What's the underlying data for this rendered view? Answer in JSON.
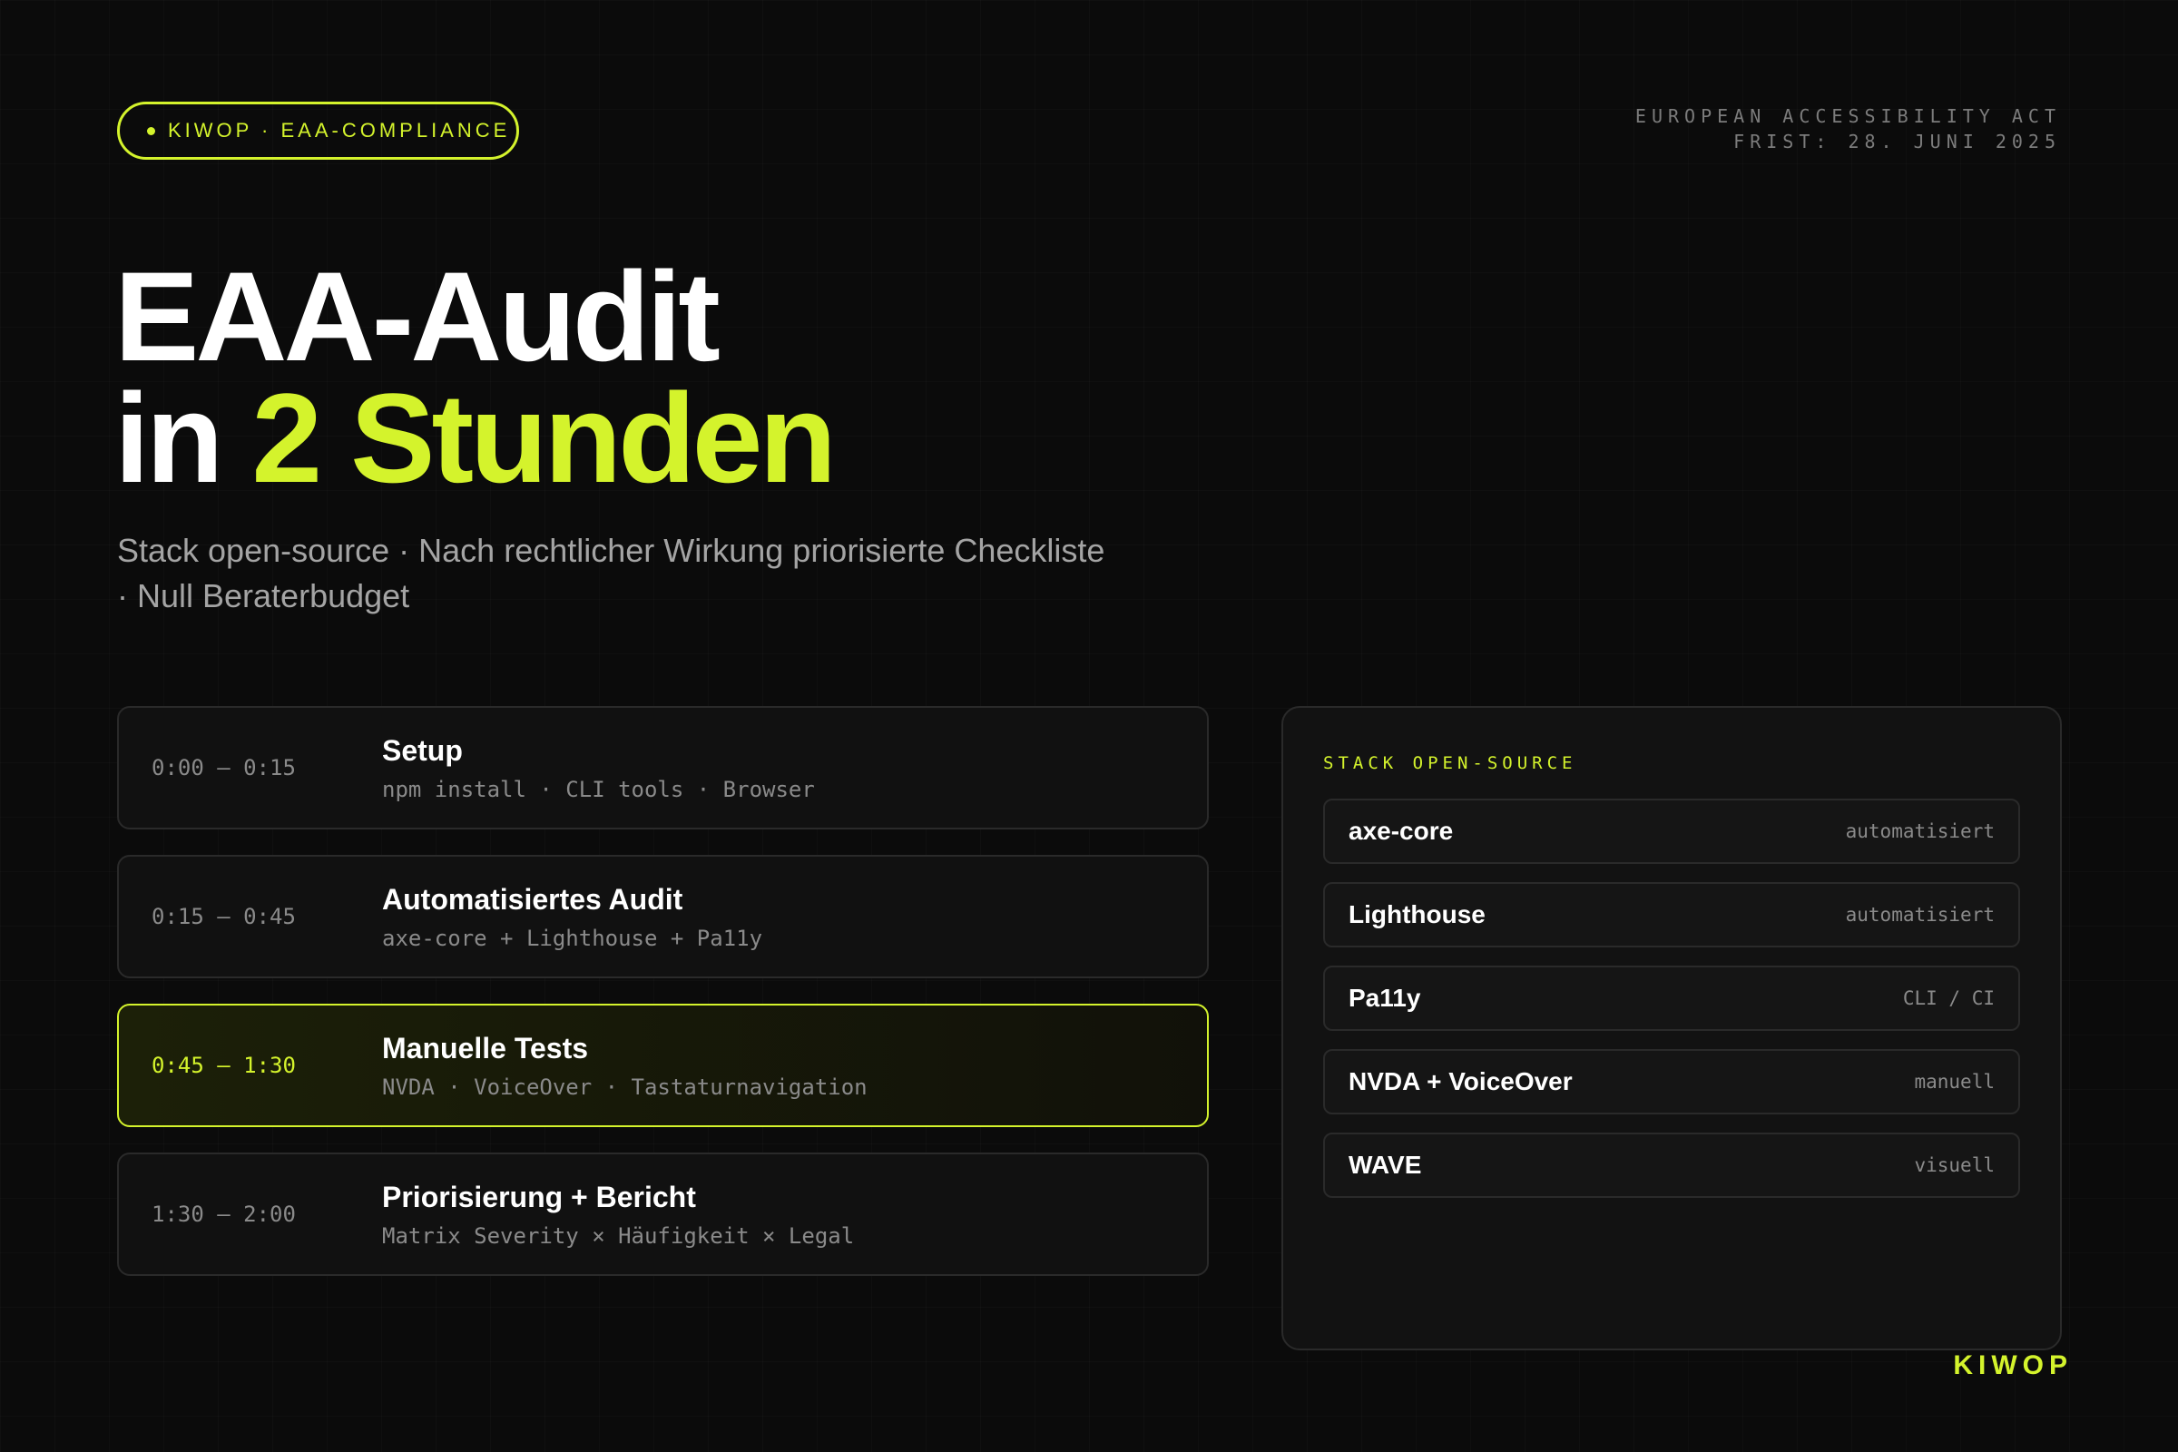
{
  "header": {
    "pill_label": "KIWOP · EAA-COMPLIANCE",
    "deadline_line1": "EUROPEAN ACCESSIBILITY ACT",
    "deadline_line2": "FRIST: 28. JUNI 2025"
  },
  "hero": {
    "title_line1": "EAA-Audit",
    "title_line2_prefix": "in",
    "title_line2_accent": "2 Stunden",
    "subtitle": "Stack open-source · Nach rechtlicher Wirkung priorisierte Checkliste · Null Beraterbudget"
  },
  "timeline": [
    {
      "time": "0:00 — 0:15",
      "title": "Setup",
      "desc": "npm install · CLI tools · Browser",
      "active": false
    },
    {
      "time": "0:15 — 0:45",
      "title": "Automatisiertes Audit",
      "desc": "axe-core + Lighthouse + Pa11y",
      "active": false
    },
    {
      "time": "0:45 — 1:30",
      "title": "Manuelle Tests",
      "desc": "NVDA · VoiceOver · Tastaturnavigation",
      "active": true
    },
    {
      "time": "1:30 — 2:00",
      "title": "Priorisierung + Bericht",
      "desc": "Matrix Severity × Häufigkeit × Legal",
      "active": false
    }
  ],
  "stack": {
    "title": "STACK OPEN-SOURCE",
    "items": [
      {
        "name": "axe-core",
        "type": "automatisiert"
      },
      {
        "name": "Lighthouse",
        "type": "automatisiert"
      },
      {
        "name": "Pa11y",
        "type": "CLI / CI"
      },
      {
        "name": "NVDA + VoiceOver",
        "type": "manuell"
      },
      {
        "name": "WAVE",
        "type": "visuell"
      }
    ]
  },
  "footer": {
    "brand": "KIWOP"
  },
  "colors": {
    "accent": "#d4f32c",
    "background": "#0b0b0b",
    "muted": "#8a8a8a"
  }
}
